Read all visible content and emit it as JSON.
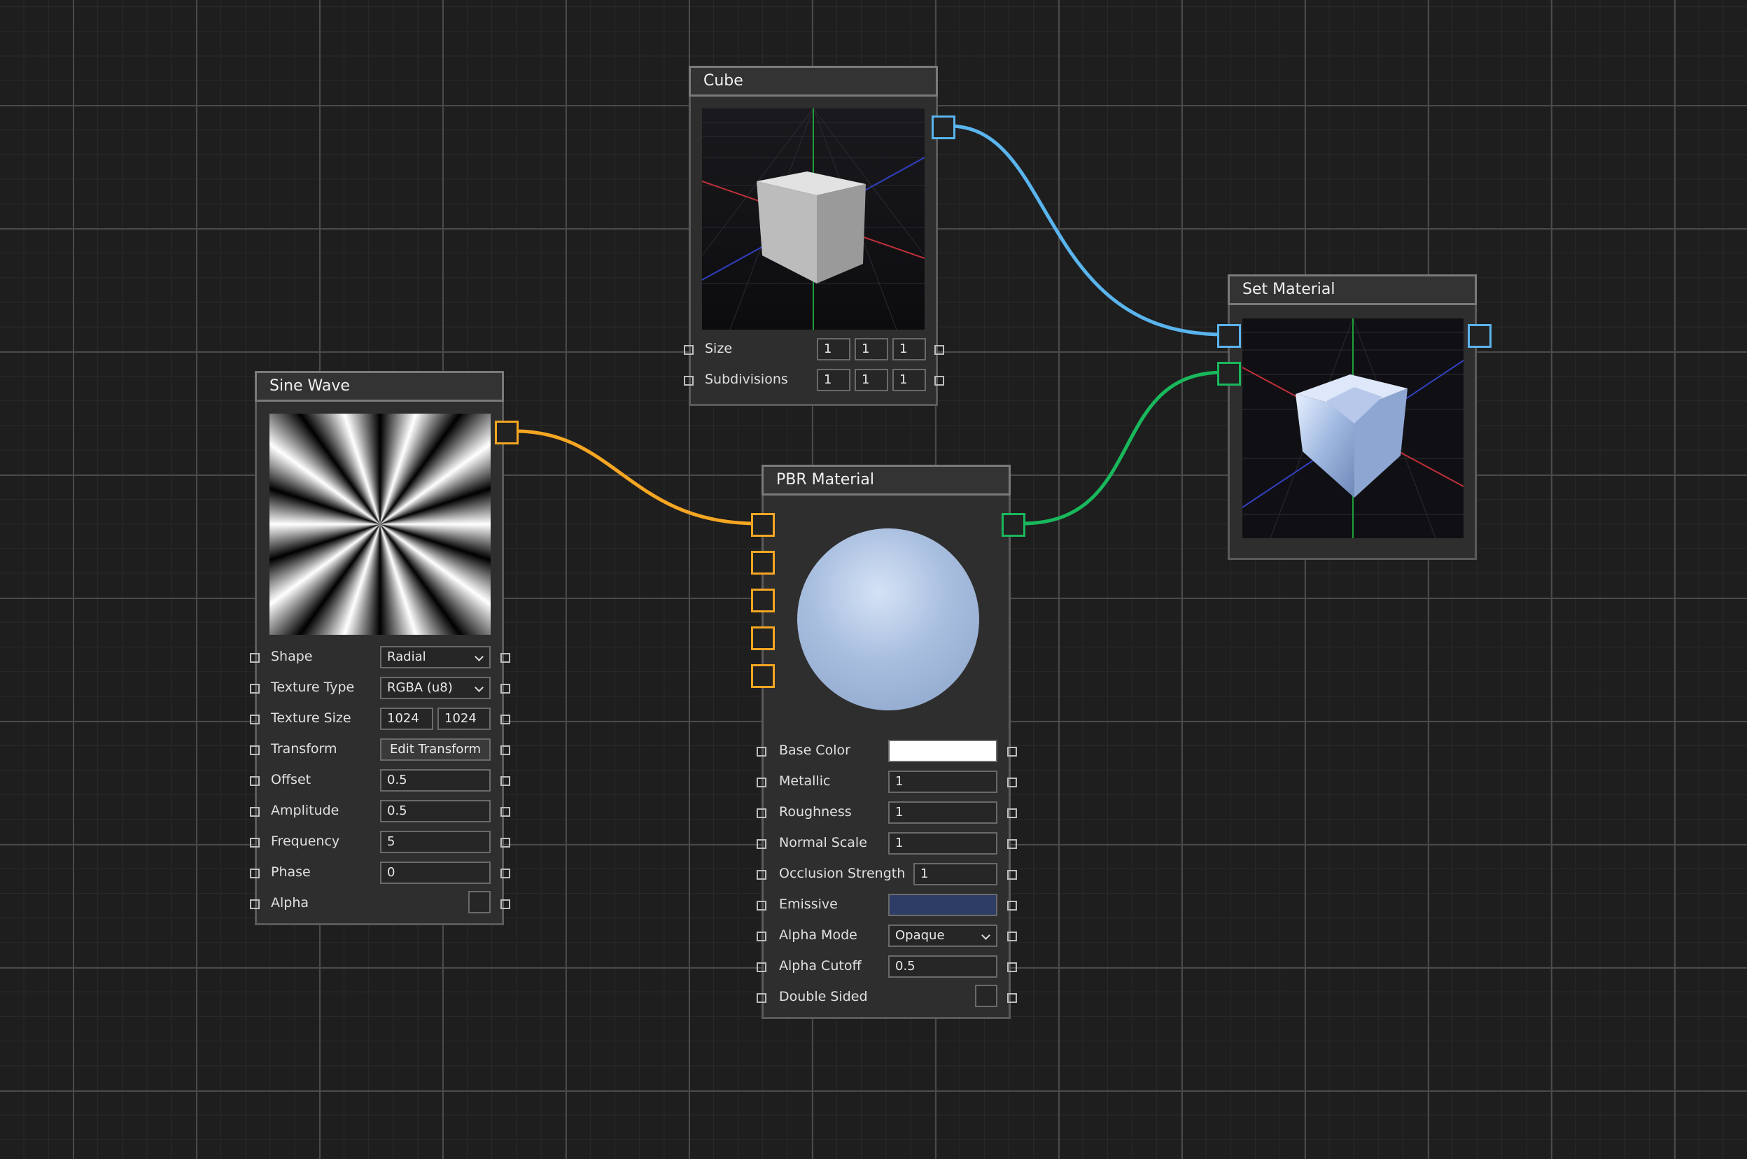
{
  "colors": {
    "orange": "#f5a623",
    "blue": "#5ab4ee",
    "green": "#19b85c",
    "emissive": "#2e3d66"
  },
  "cube": {
    "title": "Cube",
    "size_label": "Size",
    "size_values": [
      "1",
      "1",
      "1"
    ],
    "subdivisions_label": "Subdivisions",
    "subdivisions_values": [
      "1",
      "1",
      "1"
    ]
  },
  "set_material": {
    "title": "Set Material"
  },
  "sine_wave": {
    "title": "Sine Wave",
    "shape_label": "Shape",
    "shape_value": "Radial",
    "texture_type_label": "Texture Type",
    "texture_type_value": "RGBA (u8)",
    "texture_size_label": "Texture Size",
    "texture_size_w": "1024",
    "texture_size_h": "1024",
    "transform_label": "Transform",
    "transform_button": "Edit Transform",
    "offset_label": "Offset",
    "offset_value": "0.5",
    "amplitude_label": "Amplitude",
    "amplitude_value": "0.5",
    "frequency_label": "Frequency",
    "frequency_value": "5",
    "phase_label": "Phase",
    "phase_value": "0",
    "alpha_label": "Alpha"
  },
  "pbr": {
    "title": "PBR Material",
    "base_color_label": "Base Color",
    "metallic_label": "Metallic",
    "metallic_value": "1",
    "roughness_label": "Roughness",
    "roughness_value": "1",
    "normal_scale_label": "Normal Scale",
    "normal_scale_value": "1",
    "occlusion_label": "Occlusion Strength",
    "occlusion_value": "1",
    "emissive_label": "Emissive",
    "alpha_mode_label": "Alpha Mode",
    "alpha_mode_value": "Opaque",
    "alpha_cutoff_label": "Alpha Cutoff",
    "alpha_cutoff_value": "0.5",
    "double_sided_label": "Double Sided"
  }
}
